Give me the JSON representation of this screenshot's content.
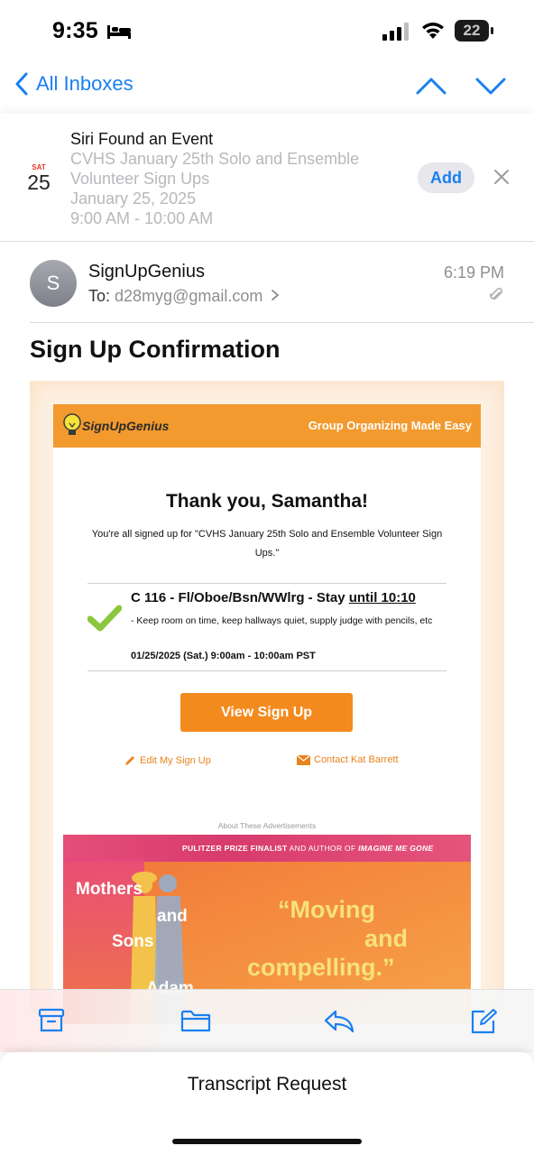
{
  "status_bar": {
    "time": "9:35",
    "battery": "22"
  },
  "nav": {
    "back_label": "All Inboxes"
  },
  "siri": {
    "title": "Siri Found an Event",
    "event_name_line1": "CVHS January 25th Solo and Ensemble",
    "event_name_line2": "Volunteer Sign Ups",
    "date": "January 25, 2025",
    "time_range": "9:00 AM - 10:00 AM",
    "cal_dow": "SAT",
    "cal_day": "25",
    "add_label": "Add"
  },
  "email": {
    "avatar_letter": "S",
    "sender": "SignUpGenius",
    "to_label": "To:",
    "to_address": "d28myg@gmail.com",
    "time": "6:19 PM",
    "subject": "Sign Up Confirmation"
  },
  "body": {
    "logo_text": "SignUpGenius",
    "tagline": "Group Organizing Made Easy",
    "thanks": "Thank you, Samantha!",
    "intro": "You're all signed up for \"CVHS January 25th Solo and Ensemble Volunteer Sign Ups.\"",
    "slot_title_main": "C 116 - Fl/Oboe/Bsn/WWlrg - Stay ",
    "slot_title_underlined": "until 10:10",
    "slot_note": "- Keep room on time, keep hallways quiet, supply judge with pencils, etc",
    "slot_date": "01/25/2025 (Sat.) 9:00am - 10:00am PST",
    "view_button": "View Sign Up",
    "edit_link": "Edit My Sign Up",
    "contact_link": "Contact Kat Barrett",
    "ad_label": "About These Advertisements"
  },
  "ad": {
    "banner_main": "PULITZER PRIZE FINALIST",
    "banner_and": " AND AUTHOR OF ",
    "banner_book": "IMAGINE ME GONE",
    "title_w1": "Mothers",
    "title_w2": "and",
    "title_w3": "Sons",
    "title_w4": "Adam",
    "quote_1": "“Moving",
    "quote_2": "and",
    "quote_3": "compelling.”"
  },
  "sheet": {
    "title": "Transcript Request"
  },
  "colors": {
    "accent": "#1a7ff1",
    "brand_orange": "#f29a2e",
    "button_orange": "#f38a1e",
    "check_green": "#8cc63f"
  }
}
